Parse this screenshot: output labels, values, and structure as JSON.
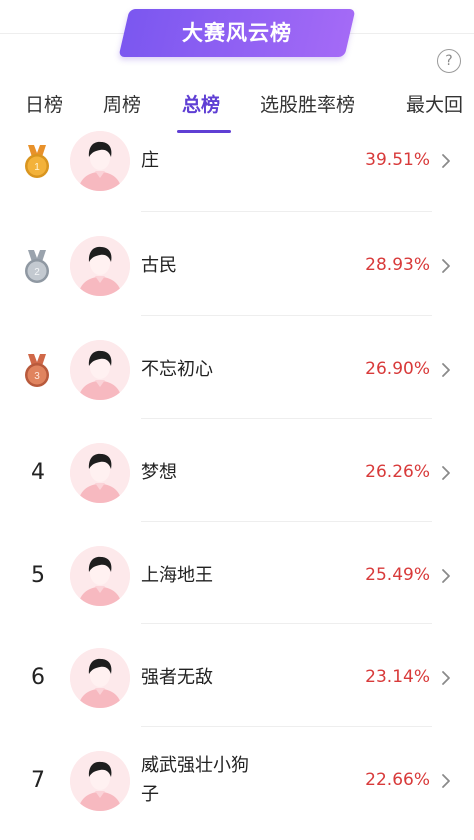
{
  "banner": {
    "title": "大赛风云榜"
  },
  "help": {
    "glyph": "?"
  },
  "tabs": [
    "日榜",
    "周榜",
    "总榜",
    "选股胜率榜",
    "最大回"
  ],
  "active_tab": "总榜",
  "colors": {
    "accent": "#5f3fd4",
    "percent": "#d83a3a",
    "banner_start": "#7b57f0",
    "banner_end": "#a46af6"
  },
  "rows": [
    {
      "rank": "1",
      "medal": "gold",
      "name": "庄",
      "pct": "39.51%"
    },
    {
      "rank": "2",
      "medal": "silver",
      "name": "古民",
      "pct": "28.93%"
    },
    {
      "rank": "3",
      "medal": "bronze",
      "name": "不忘初心",
      "pct": "26.90%"
    },
    {
      "rank": "4",
      "medal": "",
      "name": "梦想",
      "pct": "26.26%"
    },
    {
      "rank": "5",
      "medal": "",
      "name": "上海地王",
      "pct": "25.49%"
    },
    {
      "rank": "6",
      "medal": "",
      "name": "强者无敌",
      "pct": "23.14%"
    },
    {
      "rank": "7",
      "medal": "",
      "name": "威武强壮小狗",
      "name2": "子",
      "pct": "22.66%"
    }
  ]
}
